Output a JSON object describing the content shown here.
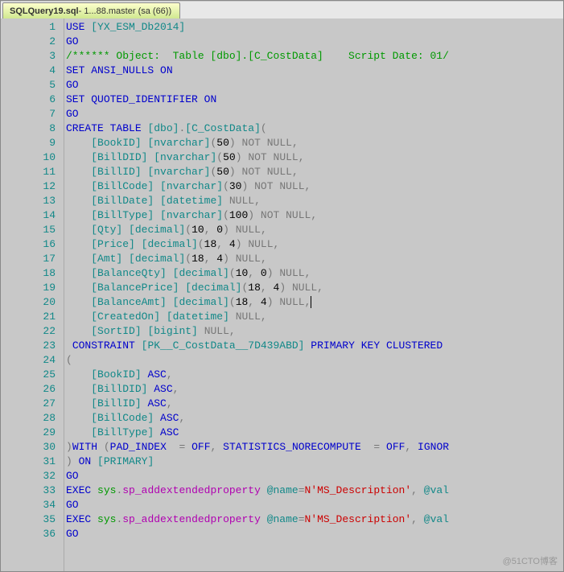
{
  "tab": {
    "filename": "SQLQuery19.sql",
    "suffix": " - 1...88.master (sa (66))"
  },
  "watermark": "@51CTO博客",
  "code_lines": [
    {
      "n": 1,
      "tokens": [
        {
          "t": "kw",
          "v": "USE"
        },
        {
          "t": "plain",
          "v": " "
        },
        {
          "t": "tk",
          "v": "[YX_ESM_Db2014]"
        }
      ]
    },
    {
      "n": 2,
      "tokens": [
        {
          "t": "kw",
          "v": "GO"
        }
      ]
    },
    {
      "n": 3,
      "tokens": [
        {
          "t": "cmnt",
          "v": "/****** Object:  Table [dbo].[C_CostData]    Script Date: 01/"
        }
      ]
    },
    {
      "n": 4,
      "tokens": [
        {
          "t": "kw",
          "v": "SET"
        },
        {
          "t": "plain",
          "v": " "
        },
        {
          "t": "kw",
          "v": "ANSI_NULLS"
        },
        {
          "t": "plain",
          "v": " "
        },
        {
          "t": "kw",
          "v": "ON"
        }
      ]
    },
    {
      "n": 5,
      "tokens": [
        {
          "t": "kw",
          "v": "GO"
        }
      ]
    },
    {
      "n": 6,
      "tokens": [
        {
          "t": "kw",
          "v": "SET"
        },
        {
          "t": "plain",
          "v": " "
        },
        {
          "t": "kw",
          "v": "QUOTED_IDENTIFIER"
        },
        {
          "t": "plain",
          "v": " "
        },
        {
          "t": "kw",
          "v": "ON"
        }
      ]
    },
    {
      "n": 7,
      "tokens": [
        {
          "t": "kw",
          "v": "GO"
        }
      ]
    },
    {
      "n": 8,
      "tokens": [
        {
          "t": "kw",
          "v": "CREATE"
        },
        {
          "t": "plain",
          "v": " "
        },
        {
          "t": "kw",
          "v": "TABLE"
        },
        {
          "t": "plain",
          "v": " "
        },
        {
          "t": "tk",
          "v": "[dbo]"
        },
        {
          "t": "op",
          "v": "."
        },
        {
          "t": "tk",
          "v": "[C_CostData]"
        },
        {
          "t": "op",
          "v": "("
        }
      ]
    },
    {
      "n": 9,
      "tokens": [
        {
          "t": "plain",
          "v": "    "
        },
        {
          "t": "tk",
          "v": "[BookID]"
        },
        {
          "t": "plain",
          "v": " "
        },
        {
          "t": "tk",
          "v": "[nvarchar]"
        },
        {
          "t": "op",
          "v": "("
        },
        {
          "t": "num",
          "v": "50"
        },
        {
          "t": "op",
          "v": ")"
        },
        {
          "t": "plain",
          "v": " "
        },
        {
          "t": "gy",
          "v": "NOT NULL"
        },
        {
          "t": "op",
          "v": ","
        }
      ]
    },
    {
      "n": 10,
      "tokens": [
        {
          "t": "plain",
          "v": "    "
        },
        {
          "t": "tk",
          "v": "[BillDID]"
        },
        {
          "t": "plain",
          "v": " "
        },
        {
          "t": "tk",
          "v": "[nvarchar]"
        },
        {
          "t": "op",
          "v": "("
        },
        {
          "t": "num",
          "v": "50"
        },
        {
          "t": "op",
          "v": ")"
        },
        {
          "t": "plain",
          "v": " "
        },
        {
          "t": "gy",
          "v": "NOT NULL"
        },
        {
          "t": "op",
          "v": ","
        }
      ]
    },
    {
      "n": 11,
      "tokens": [
        {
          "t": "plain",
          "v": "    "
        },
        {
          "t": "tk",
          "v": "[BillID]"
        },
        {
          "t": "plain",
          "v": " "
        },
        {
          "t": "tk",
          "v": "[nvarchar]"
        },
        {
          "t": "op",
          "v": "("
        },
        {
          "t": "num",
          "v": "50"
        },
        {
          "t": "op",
          "v": ")"
        },
        {
          "t": "plain",
          "v": " "
        },
        {
          "t": "gy",
          "v": "NOT NULL"
        },
        {
          "t": "op",
          "v": ","
        }
      ]
    },
    {
      "n": 12,
      "tokens": [
        {
          "t": "plain",
          "v": "    "
        },
        {
          "t": "tk",
          "v": "[BillCode]"
        },
        {
          "t": "plain",
          "v": " "
        },
        {
          "t": "tk",
          "v": "[nvarchar]"
        },
        {
          "t": "op",
          "v": "("
        },
        {
          "t": "num",
          "v": "30"
        },
        {
          "t": "op",
          "v": ")"
        },
        {
          "t": "plain",
          "v": " "
        },
        {
          "t": "gy",
          "v": "NOT NULL"
        },
        {
          "t": "op",
          "v": ","
        }
      ]
    },
    {
      "n": 13,
      "tokens": [
        {
          "t": "plain",
          "v": "    "
        },
        {
          "t": "tk",
          "v": "[BillDate]"
        },
        {
          "t": "plain",
          "v": " "
        },
        {
          "t": "tk",
          "v": "[datetime]"
        },
        {
          "t": "plain",
          "v": " "
        },
        {
          "t": "gy",
          "v": "NULL"
        },
        {
          "t": "op",
          "v": ","
        }
      ]
    },
    {
      "n": 14,
      "tokens": [
        {
          "t": "plain",
          "v": "    "
        },
        {
          "t": "tk",
          "v": "[BillType]"
        },
        {
          "t": "plain",
          "v": " "
        },
        {
          "t": "tk",
          "v": "[nvarchar]"
        },
        {
          "t": "op",
          "v": "("
        },
        {
          "t": "num",
          "v": "100"
        },
        {
          "t": "op",
          "v": ")"
        },
        {
          "t": "plain",
          "v": " "
        },
        {
          "t": "gy",
          "v": "NOT NULL"
        },
        {
          "t": "op",
          "v": ","
        }
      ]
    },
    {
      "n": 15,
      "tokens": [
        {
          "t": "plain",
          "v": "    "
        },
        {
          "t": "tk",
          "v": "[Qty]"
        },
        {
          "t": "plain",
          "v": " "
        },
        {
          "t": "tk",
          "v": "[decimal]"
        },
        {
          "t": "op",
          "v": "("
        },
        {
          "t": "num",
          "v": "10"
        },
        {
          "t": "op",
          "v": ", "
        },
        {
          "t": "num",
          "v": "0"
        },
        {
          "t": "op",
          "v": ")"
        },
        {
          "t": "plain",
          "v": " "
        },
        {
          "t": "gy",
          "v": "NULL"
        },
        {
          "t": "op",
          "v": ","
        }
      ]
    },
    {
      "n": 16,
      "tokens": [
        {
          "t": "plain",
          "v": "    "
        },
        {
          "t": "tk",
          "v": "[Price]"
        },
        {
          "t": "plain",
          "v": " "
        },
        {
          "t": "tk",
          "v": "[decimal]"
        },
        {
          "t": "op",
          "v": "("
        },
        {
          "t": "num",
          "v": "18"
        },
        {
          "t": "op",
          "v": ", "
        },
        {
          "t": "num",
          "v": "4"
        },
        {
          "t": "op",
          "v": ")"
        },
        {
          "t": "plain",
          "v": " "
        },
        {
          "t": "gy",
          "v": "NULL"
        },
        {
          "t": "op",
          "v": ","
        }
      ]
    },
    {
      "n": 17,
      "tokens": [
        {
          "t": "plain",
          "v": "    "
        },
        {
          "t": "tk",
          "v": "[Amt]"
        },
        {
          "t": "plain",
          "v": " "
        },
        {
          "t": "tk",
          "v": "[decimal]"
        },
        {
          "t": "op",
          "v": "("
        },
        {
          "t": "num",
          "v": "18"
        },
        {
          "t": "op",
          "v": ", "
        },
        {
          "t": "num",
          "v": "4"
        },
        {
          "t": "op",
          "v": ")"
        },
        {
          "t": "plain",
          "v": " "
        },
        {
          "t": "gy",
          "v": "NULL"
        },
        {
          "t": "op",
          "v": ","
        }
      ]
    },
    {
      "n": 18,
      "tokens": [
        {
          "t": "plain",
          "v": "    "
        },
        {
          "t": "tk",
          "v": "[BalanceQty]"
        },
        {
          "t": "plain",
          "v": " "
        },
        {
          "t": "tk",
          "v": "[decimal]"
        },
        {
          "t": "op",
          "v": "("
        },
        {
          "t": "num",
          "v": "10"
        },
        {
          "t": "op",
          "v": ", "
        },
        {
          "t": "num",
          "v": "0"
        },
        {
          "t": "op",
          "v": ")"
        },
        {
          "t": "plain",
          "v": " "
        },
        {
          "t": "gy",
          "v": "NULL"
        },
        {
          "t": "op",
          "v": ","
        }
      ]
    },
    {
      "n": 19,
      "tokens": [
        {
          "t": "plain",
          "v": "    "
        },
        {
          "t": "tk",
          "v": "[BalancePrice]"
        },
        {
          "t": "plain",
          "v": " "
        },
        {
          "t": "tk",
          "v": "[decimal]"
        },
        {
          "t": "op",
          "v": "("
        },
        {
          "t": "num",
          "v": "18"
        },
        {
          "t": "op",
          "v": ", "
        },
        {
          "t": "num",
          "v": "4"
        },
        {
          "t": "op",
          "v": ")"
        },
        {
          "t": "plain",
          "v": " "
        },
        {
          "t": "gy",
          "v": "NULL"
        },
        {
          "t": "op",
          "v": ","
        }
      ]
    },
    {
      "n": 20,
      "tokens": [
        {
          "t": "plain",
          "v": "    "
        },
        {
          "t": "tk",
          "v": "[BalanceAmt]"
        },
        {
          "t": "plain",
          "v": " "
        },
        {
          "t": "tk",
          "v": "[decimal]"
        },
        {
          "t": "op",
          "v": "("
        },
        {
          "t": "num",
          "v": "18"
        },
        {
          "t": "op",
          "v": ", "
        },
        {
          "t": "num",
          "v": "4"
        },
        {
          "t": "op",
          "v": ")"
        },
        {
          "t": "plain",
          "v": " "
        },
        {
          "t": "gy",
          "v": "NULL"
        },
        {
          "t": "op",
          "v": ","
        },
        {
          "t": "caret",
          "v": ""
        }
      ]
    },
    {
      "n": 21,
      "tokens": [
        {
          "t": "plain",
          "v": "    "
        },
        {
          "t": "tk",
          "v": "[CreatedOn]"
        },
        {
          "t": "plain",
          "v": " "
        },
        {
          "t": "tk",
          "v": "[datetime]"
        },
        {
          "t": "plain",
          "v": " "
        },
        {
          "t": "gy",
          "v": "NULL"
        },
        {
          "t": "op",
          "v": ","
        }
      ]
    },
    {
      "n": 22,
      "tokens": [
        {
          "t": "plain",
          "v": "    "
        },
        {
          "t": "tk",
          "v": "[SortID]"
        },
        {
          "t": "plain",
          "v": " "
        },
        {
          "t": "tk",
          "v": "[bigint]"
        },
        {
          "t": "plain",
          "v": " "
        },
        {
          "t": "gy",
          "v": "NULL"
        },
        {
          "t": "op",
          "v": ","
        }
      ]
    },
    {
      "n": 23,
      "tokens": [
        {
          "t": "plain",
          "v": " "
        },
        {
          "t": "kw",
          "v": "CONSTRAINT"
        },
        {
          "t": "plain",
          "v": " "
        },
        {
          "t": "tk",
          "v": "[PK__C_CostData__7D439ABD]"
        },
        {
          "t": "plain",
          "v": " "
        },
        {
          "t": "kw",
          "v": "PRIMARY"
        },
        {
          "t": "plain",
          "v": " "
        },
        {
          "t": "kw",
          "v": "KEY"
        },
        {
          "t": "plain",
          "v": " "
        },
        {
          "t": "kw",
          "v": "CLUSTERED"
        },
        {
          "t": "plain",
          "v": " "
        }
      ]
    },
    {
      "n": 24,
      "tokens": [
        {
          "t": "op",
          "v": "("
        }
      ]
    },
    {
      "n": 25,
      "tokens": [
        {
          "t": "plain",
          "v": "    "
        },
        {
          "t": "tk",
          "v": "[BookID]"
        },
        {
          "t": "plain",
          "v": " "
        },
        {
          "t": "kw",
          "v": "ASC"
        },
        {
          "t": "op",
          "v": ","
        }
      ]
    },
    {
      "n": 26,
      "tokens": [
        {
          "t": "plain",
          "v": "    "
        },
        {
          "t": "tk",
          "v": "[BillDID]"
        },
        {
          "t": "plain",
          "v": " "
        },
        {
          "t": "kw",
          "v": "ASC"
        },
        {
          "t": "op",
          "v": ","
        }
      ]
    },
    {
      "n": 27,
      "tokens": [
        {
          "t": "plain",
          "v": "    "
        },
        {
          "t": "tk",
          "v": "[BillID]"
        },
        {
          "t": "plain",
          "v": " "
        },
        {
          "t": "kw",
          "v": "ASC"
        },
        {
          "t": "op",
          "v": ","
        }
      ]
    },
    {
      "n": 28,
      "tokens": [
        {
          "t": "plain",
          "v": "    "
        },
        {
          "t": "tk",
          "v": "[BillCode]"
        },
        {
          "t": "plain",
          "v": " "
        },
        {
          "t": "kw",
          "v": "ASC"
        },
        {
          "t": "op",
          "v": ","
        }
      ]
    },
    {
      "n": 29,
      "tokens": [
        {
          "t": "plain",
          "v": "    "
        },
        {
          "t": "tk",
          "v": "[BillType]"
        },
        {
          "t": "plain",
          "v": " "
        },
        {
          "t": "kw",
          "v": "ASC"
        }
      ]
    },
    {
      "n": 30,
      "tokens": [
        {
          "t": "op",
          "v": ")"
        },
        {
          "t": "kw",
          "v": "WITH"
        },
        {
          "t": "plain",
          "v": " "
        },
        {
          "t": "op",
          "v": "("
        },
        {
          "t": "kw",
          "v": "PAD_INDEX"
        },
        {
          "t": "plain",
          "v": "  "
        },
        {
          "t": "op",
          "v": "="
        },
        {
          "t": "plain",
          "v": " "
        },
        {
          "t": "kw",
          "v": "OFF"
        },
        {
          "t": "op",
          "v": ","
        },
        {
          "t": "plain",
          "v": " "
        },
        {
          "t": "kw",
          "v": "STATISTICS_NORECOMPUTE"
        },
        {
          "t": "plain",
          "v": "  "
        },
        {
          "t": "op",
          "v": "="
        },
        {
          "t": "plain",
          "v": " "
        },
        {
          "t": "kw",
          "v": "OFF"
        },
        {
          "t": "op",
          "v": ","
        },
        {
          "t": "plain",
          "v": " "
        },
        {
          "t": "kw",
          "v": "IGNOR"
        }
      ]
    },
    {
      "n": 31,
      "tokens": [
        {
          "t": "op",
          "v": ")"
        },
        {
          "t": "plain",
          "v": " "
        },
        {
          "t": "kw",
          "v": "ON"
        },
        {
          "t": "plain",
          "v": " "
        },
        {
          "t": "tk",
          "v": "[PRIMARY]"
        }
      ]
    },
    {
      "n": 32,
      "tokens": [
        {
          "t": "kw",
          "v": "GO"
        }
      ]
    },
    {
      "n": 33,
      "tokens": [
        {
          "t": "kw",
          "v": "EXEC"
        },
        {
          "t": "plain",
          "v": " "
        },
        {
          "t": "sys",
          "v": "sys"
        },
        {
          "t": "op",
          "v": "."
        },
        {
          "t": "fn",
          "v": "sp_addextendedproperty"
        },
        {
          "t": "plain",
          "v": " "
        },
        {
          "t": "tk",
          "v": "@name"
        },
        {
          "t": "op",
          "v": "="
        },
        {
          "t": "str",
          "v": "N'MS_Description'"
        },
        {
          "t": "op",
          "v": ","
        },
        {
          "t": "plain",
          "v": " "
        },
        {
          "t": "tk",
          "v": "@val"
        }
      ]
    },
    {
      "n": 34,
      "tokens": [
        {
          "t": "kw",
          "v": "GO"
        }
      ]
    },
    {
      "n": 35,
      "tokens": [
        {
          "t": "kw",
          "v": "EXEC"
        },
        {
          "t": "plain",
          "v": " "
        },
        {
          "t": "sys",
          "v": "sys"
        },
        {
          "t": "op",
          "v": "."
        },
        {
          "t": "fn",
          "v": "sp_addextendedproperty"
        },
        {
          "t": "plain",
          "v": " "
        },
        {
          "t": "tk",
          "v": "@name"
        },
        {
          "t": "op",
          "v": "="
        },
        {
          "t": "str",
          "v": "N'MS_Description'"
        },
        {
          "t": "op",
          "v": ","
        },
        {
          "t": "plain",
          "v": " "
        },
        {
          "t": "tk",
          "v": "@val"
        }
      ]
    },
    {
      "n": 36,
      "tokens": [
        {
          "t": "kw",
          "v": "GO"
        }
      ]
    }
  ]
}
